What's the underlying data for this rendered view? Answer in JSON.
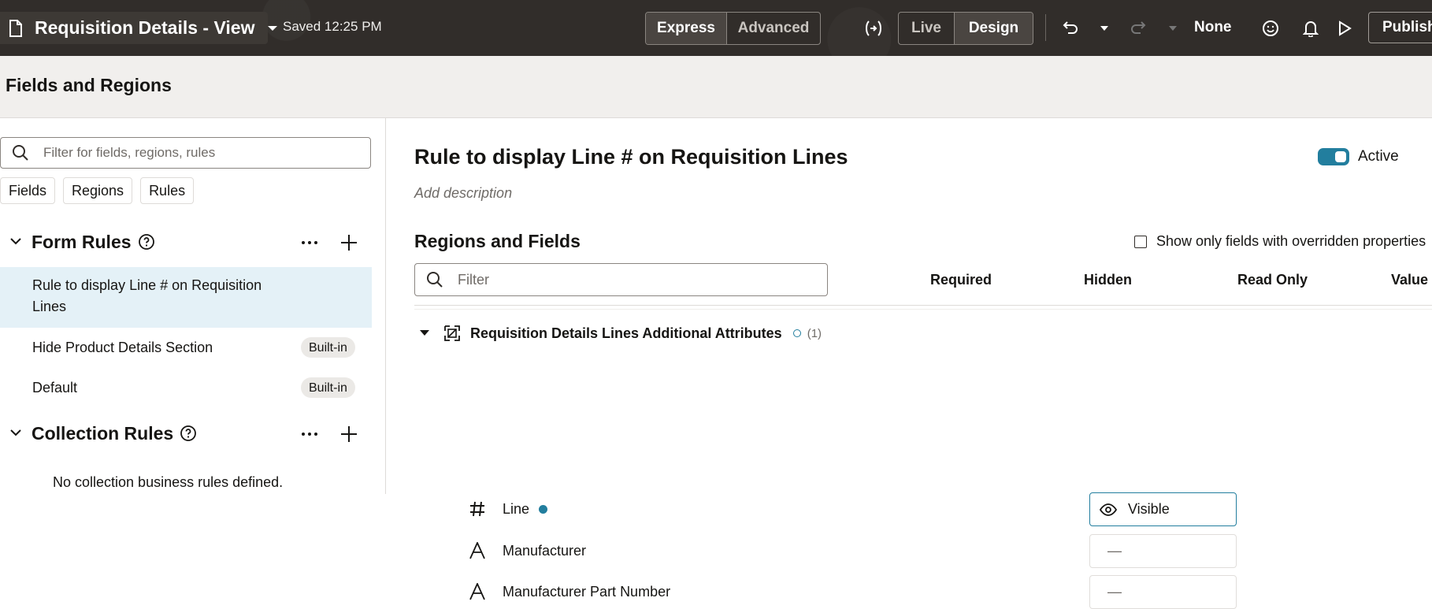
{
  "topbar": {
    "page_title": "Requisition Details - View",
    "saved_text": "Saved 12:25 PM",
    "mode_express": "Express",
    "mode_advanced": "Advanced",
    "view_live": "Live",
    "view_design": "Design",
    "sandbox_label": "None",
    "publish_label": "Publish",
    "bg_color": "#312d2a"
  },
  "subheader": {
    "title": "Fields and Regions"
  },
  "left": {
    "search_placeholder": "Filter for fields, regions, rules",
    "chips": [
      "Fields",
      "Regions",
      "Rules"
    ],
    "form_rules": {
      "title": "Form Rules",
      "items": [
        {
          "label": "Rule to display Line # on Requisition Lines",
          "badge": ""
        },
        {
          "label": "Hide Product Details Section",
          "badge": "Built-in"
        },
        {
          "label": "Default",
          "badge": "Built-in"
        }
      ]
    },
    "collection_rules": {
      "title": "Collection Rules",
      "empty_message": "No collection business rules defined."
    }
  },
  "right": {
    "rule_title": "Rule to display Line # on Requisition Lines",
    "add_description": "Add description",
    "active_label": "Active",
    "active": true,
    "regions_title": "Regions and Fields",
    "override_checkbox_label": "Show only fields with overridden properties",
    "filter_placeholder": "Filter",
    "columns": [
      "Required",
      "Hidden",
      "Read Only",
      "Value"
    ],
    "region": {
      "name": "Requisition Details Lines Additional Attributes",
      "count": "(1)"
    },
    "fields": [
      {
        "icon": "hash-icon",
        "name": "Line",
        "modified": true,
        "read_only_value": "Visible"
      },
      {
        "icon": "text-icon",
        "name": "Manufacturer",
        "modified": false,
        "read_only_value": "—"
      },
      {
        "icon": "text-icon",
        "name": "Manufacturer Part Number",
        "modified": false,
        "read_only_value": "—"
      }
    ],
    "accent_color": "#227e9e"
  }
}
